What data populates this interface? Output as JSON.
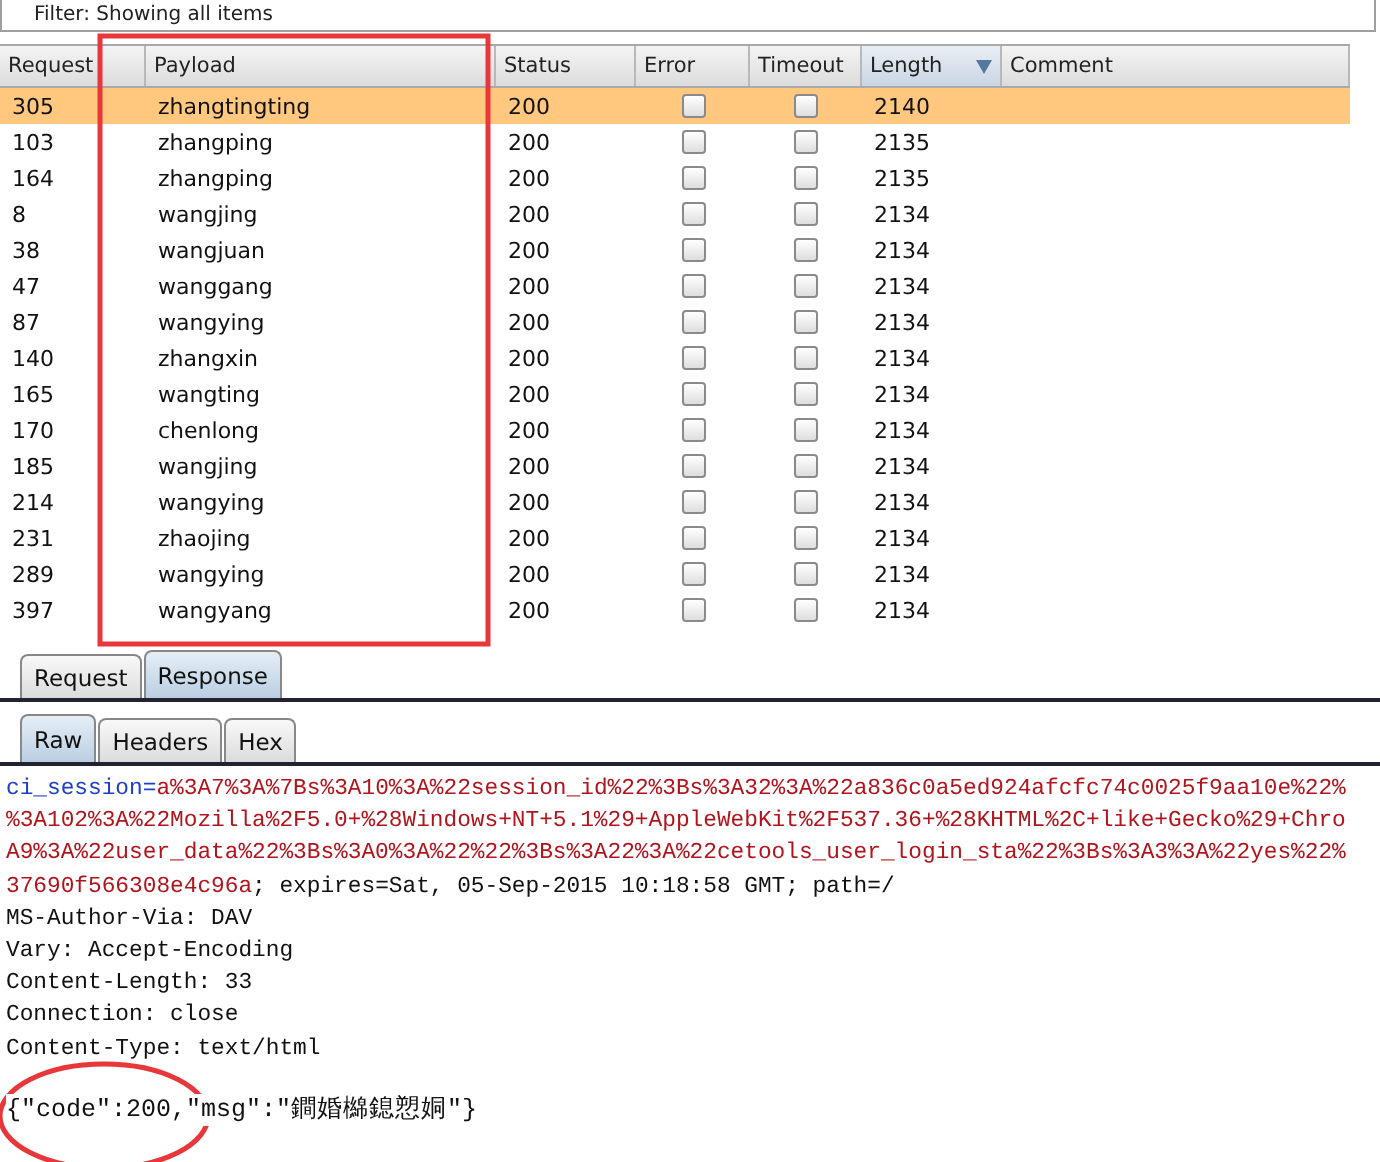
{
  "filter": {
    "text": "Filter: Showing all items"
  },
  "table": {
    "columns": [
      {
        "label": "Request",
        "sorted": false
      },
      {
        "label": "Payload",
        "sorted": false
      },
      {
        "label": "Status",
        "sorted": false
      },
      {
        "label": "Error",
        "sorted": false
      },
      {
        "label": "Timeout",
        "sorted": false
      },
      {
        "label": "Length",
        "sorted": true
      },
      {
        "label": "Comment",
        "sorted": false
      }
    ],
    "rows": [
      {
        "request": "305",
        "payload": "zhangtingting",
        "status": "200",
        "error": false,
        "timeout": false,
        "length": "2140",
        "selected": true
      },
      {
        "request": "103",
        "payload": "zhangping",
        "status": "200",
        "error": false,
        "timeout": false,
        "length": "2135",
        "selected": false
      },
      {
        "request": "164",
        "payload": "zhangping",
        "status": "200",
        "error": false,
        "timeout": false,
        "length": "2135",
        "selected": false
      },
      {
        "request": "8",
        "payload": "wangjing",
        "status": "200",
        "error": false,
        "timeout": false,
        "length": "2134",
        "selected": false
      },
      {
        "request": "38",
        "payload": "wangjuan",
        "status": "200",
        "error": false,
        "timeout": false,
        "length": "2134",
        "selected": false
      },
      {
        "request": "47",
        "payload": "wanggang",
        "status": "200",
        "error": false,
        "timeout": false,
        "length": "2134",
        "selected": false
      },
      {
        "request": "87",
        "payload": "wangying",
        "status": "200",
        "error": false,
        "timeout": false,
        "length": "2134",
        "selected": false
      },
      {
        "request": "140",
        "payload": "zhangxin",
        "status": "200",
        "error": false,
        "timeout": false,
        "length": "2134",
        "selected": false
      },
      {
        "request": "165",
        "payload": "wangting",
        "status": "200",
        "error": false,
        "timeout": false,
        "length": "2134",
        "selected": false
      },
      {
        "request": "170",
        "payload": "chenlong",
        "status": "200",
        "error": false,
        "timeout": false,
        "length": "2134",
        "selected": false
      },
      {
        "request": "185",
        "payload": "wangjing",
        "status": "200",
        "error": false,
        "timeout": false,
        "length": "2134",
        "selected": false
      },
      {
        "request": "214",
        "payload": "wangying",
        "status": "200",
        "error": false,
        "timeout": false,
        "length": "2134",
        "selected": false
      },
      {
        "request": "231",
        "payload": "zhaojing",
        "status": "200",
        "error": false,
        "timeout": false,
        "length": "2134",
        "selected": false
      },
      {
        "request": "289",
        "payload": "wangying",
        "status": "200",
        "error": false,
        "timeout": false,
        "length": "2134",
        "selected": false
      },
      {
        "request": "397",
        "payload": "wangyang",
        "status": "200",
        "error": false,
        "timeout": false,
        "length": "2134",
        "selected": false
      }
    ]
  },
  "tabs": [
    {
      "label": "Request",
      "selected": false
    },
    {
      "label": "Response",
      "selected": true
    }
  ],
  "subtabs": [
    {
      "label": "Raw",
      "selected": true
    },
    {
      "label": "Headers",
      "selected": false
    },
    {
      "label": "Hex",
      "selected": false
    }
  ],
  "response_lines": [
    [
      {
        "kind": "name",
        "text": "ci_session="
      },
      {
        "kind": "value",
        "text": "a%3A7%3A%7Bs%3A10%3A%22session_id%22%3Bs%3A32%3A%22a836c0a5ed924afcfc74c0025f9aa10e%22%"
      }
    ],
    [
      {
        "kind": "value",
        "text": "%3A102%3A%22Mozilla%2F5.0+%28Windows+NT+5.1%29+AppleWebKit%2F537.36+%28KHTML%2C+like+Gecko%29+Chro"
      }
    ],
    [
      {
        "kind": "value",
        "text": "A9%3A%22user_data%22%3Bs%3A0%3A%22%22%3Bs%3A22%3A%22cetools_user_login_sta%22%3Bs%3A3%3A%22yes%22%"
      }
    ],
    [
      {
        "kind": "value",
        "text": "37690f566308e4c96a"
      },
      {
        "kind": "plain",
        "text": "; expires=Sat, 05-Sep-2015 10:18:58 GMT; path=/"
      }
    ],
    [
      {
        "kind": "plain",
        "text": "MS-Author-Via: DAV"
      }
    ],
    [
      {
        "kind": "plain",
        "text": "Vary: Accept-Encoding"
      }
    ],
    [
      {
        "kind": "plain",
        "text": "Content-Length: 33"
      }
    ],
    [
      {
        "kind": "plain",
        "text": "Connection: close"
      }
    ],
    [
      {
        "kind": "plain",
        "text": "Content-Type: text/html"
      }
    ]
  ],
  "body": "{\"code\":200,\"msg\":\"鐧婚檰鎴愬姛\"}",
  "annotations": [
    {
      "kind": "rectangle"
    },
    {
      "kind": "ellipse"
    }
  ]
}
